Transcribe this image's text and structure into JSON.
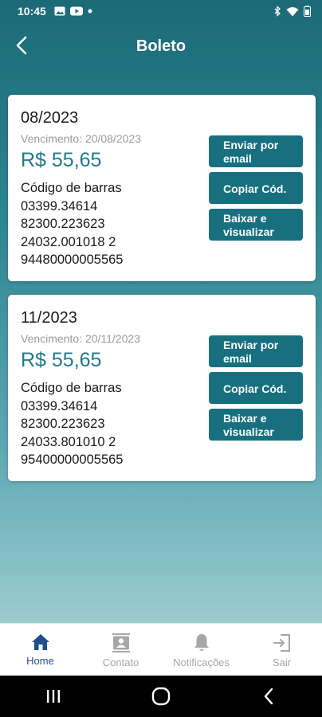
{
  "status_bar": {
    "time": "10:45",
    "notification_icons": [
      "image-icon",
      "youtube-icon",
      "dot-icon"
    ],
    "system_icons": [
      "bluetooth-icon",
      "wifi-icon",
      "battery-icon"
    ]
  },
  "header": {
    "title": "Boleto",
    "back_icon": "chevron-left-icon"
  },
  "boletos": [
    {
      "month": "08/2023",
      "due": "Vencimento: 20/08/2023",
      "amount": "R$ 55,65",
      "barcode_label": "Código de barras",
      "barcode_lines": [
        "03399.34614",
        "82300.223623",
        "24032.001018 2",
        "94480000005565"
      ],
      "buttons": {
        "email": "Enviar por email",
        "copy": "Copiar Cód.",
        "download": "Baixar e visualizar"
      }
    },
    {
      "month": "11/2023",
      "due": "Vencimento: 20/11/2023",
      "amount": "R$ 55,65",
      "barcode_label": "Código de barras",
      "barcode_lines": [
        "03399.34614",
        "82300.223623",
        "24033.801010 2",
        "95400000005565"
      ],
      "buttons": {
        "email": "Enviar por email",
        "copy": "Copiar Cód.",
        "download": "Baixar e visualizar"
      }
    }
  ],
  "bottom_nav": [
    {
      "label": "Home",
      "icon": "home-icon",
      "active": true
    },
    {
      "label": "Contato",
      "icon": "contact-icon",
      "active": false
    },
    {
      "label": "Notificações",
      "icon": "bell-icon",
      "active": false
    },
    {
      "label": "Sair",
      "icon": "logout-icon",
      "active": false
    }
  ],
  "colors": {
    "accent": "#18707f",
    "amount": "#1f7a8c",
    "nav_active": "#1f4f8c",
    "nav_inactive": "#a7a7a7"
  }
}
